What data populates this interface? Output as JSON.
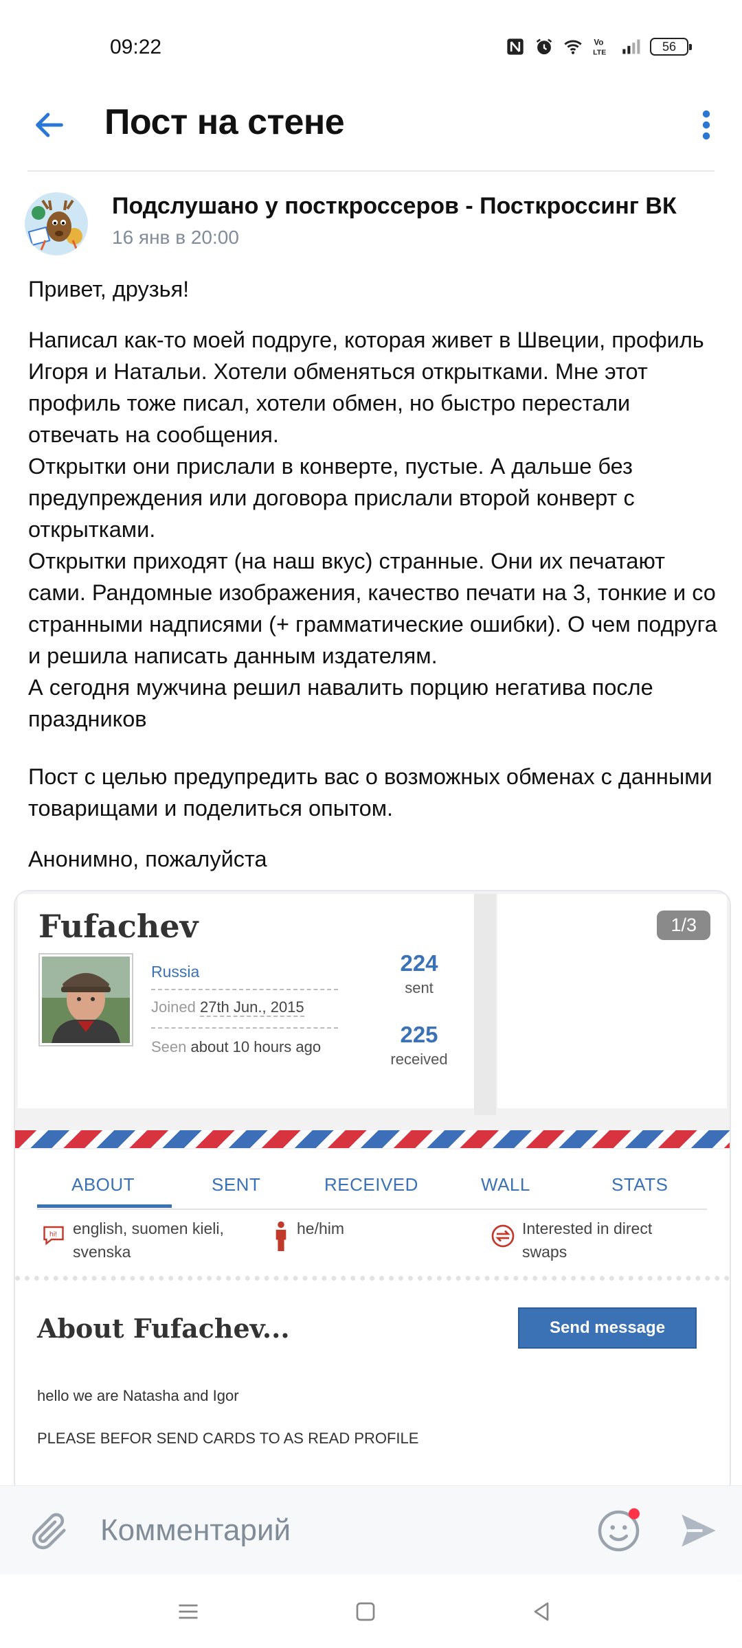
{
  "status_bar": {
    "time": "09:22",
    "battery": "56",
    "icons": [
      "nfc-icon",
      "alarm-icon",
      "wifi-icon",
      "volte-icon",
      "signal-icon",
      "battery-icon"
    ]
  },
  "header": {
    "title": "Пост на стене",
    "back_icon": "arrow-left-icon",
    "more_icon": "more-vertical-icon"
  },
  "post": {
    "author": "Подслушано у посткроссеров - Посткроссинг ВК",
    "date": "16 янв в 20:00",
    "paragraphs": [
      "Привет, друзья!",
      "Написал как-то моей подруге, которая живет в Швеции, профиль Игоря и Натальи. Хотели обменяться открытками. Мне этот профиль тоже писал, хотели обмен, но быстро перестали отвечать на сообщения.",
      "Открытки они прислали в конверте, пустые. А дальше без предупреждения или договора прислали второй конверт с открытками.",
      "Открытки приходят (на наш вкус) странные. Они их печатают сами. Рандомные изображения, качество печати на 3, тонкие и со странными надписями (+ грамматические ошибки). О чем подруга и решила написать данным издателям.",
      "А сегодня мужчина решил навалить порцию негатива после праздников",
      "Пост с целью предупредить вас о возможных обменах с данными товарищами и поделиться опытом.",
      "Анонимно, пожалуйста"
    ]
  },
  "attachment": {
    "counter": "1/3",
    "profile": {
      "username": "Fufachev",
      "country": "Russia",
      "joined_label": "Joined",
      "joined_date": "27th Jun., 2015",
      "seen_label": "Seen",
      "seen_value": "about 10 hours ago",
      "sent_count": "224",
      "sent_label": "sent",
      "received_count": "225",
      "received_label": "received"
    },
    "tabs": [
      "ABOUT",
      "SENT",
      "RECEIVED",
      "WALL",
      "STATS"
    ],
    "active_tab": "ABOUT",
    "languages_line1": "english, suomen kieli,",
    "languages_line2": "svenska",
    "pronouns": "he/him",
    "swaps_line1": "Interested in direct",
    "swaps_line2": "swaps",
    "about_title": "About Fufachev...",
    "send_message": "Send message",
    "about_line1": "hello we are Natasha and Igor",
    "about_line2": "PLEASE BEFOR SEND CARDS TO AS READ PROFILE"
  },
  "composer": {
    "placeholder": "Комментарий",
    "attach_icon": "paperclip-icon",
    "emoji_icon": "smile-icon",
    "send_icon": "send-icon"
  },
  "colors": {
    "accent": "#2a77d6",
    "text_secondary": "#818c99",
    "postcrossing_blue": "#3b72b6",
    "airmail_red": "#d8343f"
  }
}
